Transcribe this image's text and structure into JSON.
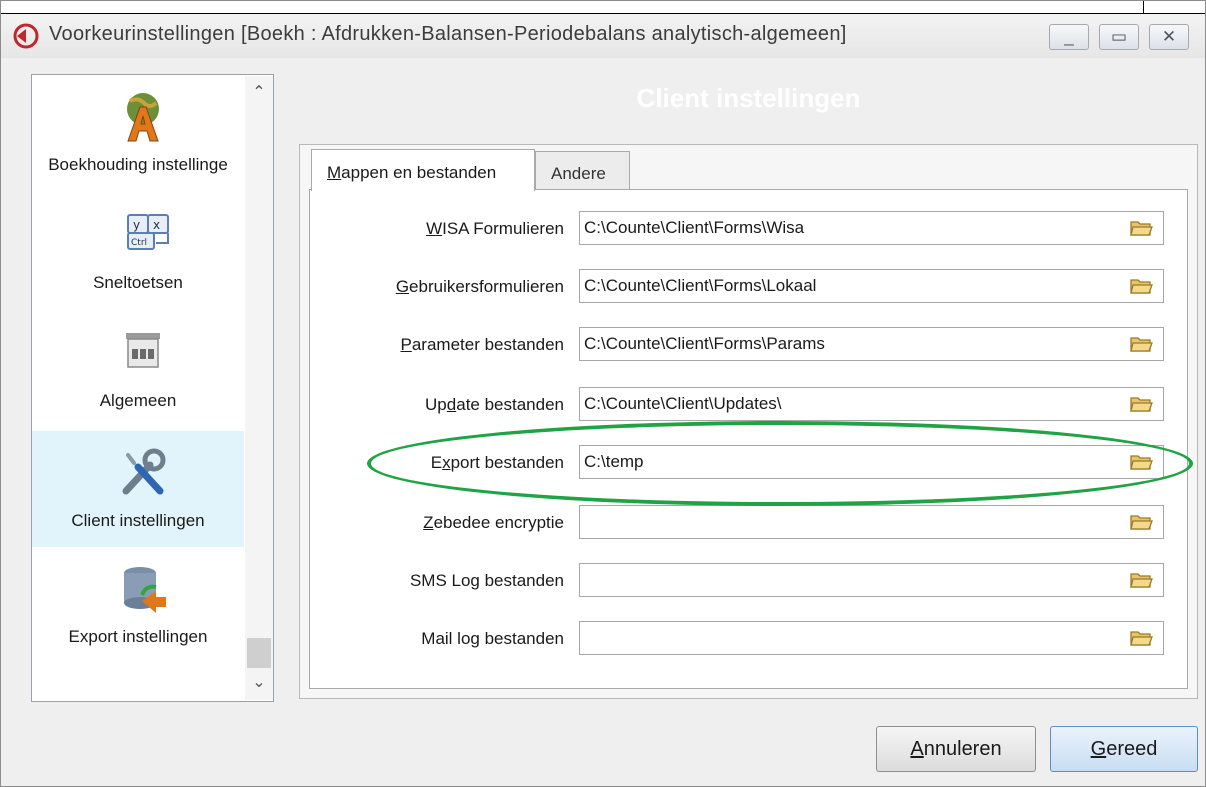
{
  "window": {
    "title": "Voorkeurinstellingen [Boekh : Afdrukken-Balansen-Periodebalans analytisch-algemeen]",
    "minimize_symbol": "_",
    "maximize_symbol": "▭",
    "close_symbol": "✕"
  },
  "sidebar": {
    "items": [
      {
        "label": "Boekhouding instellinge",
        "icon": "accounting-globe-icon"
      },
      {
        "label": "Sneltoetsen",
        "icon": "keyboard-shortcut-icon"
      },
      {
        "label": "Algemeen",
        "icon": "general-settings-icon"
      },
      {
        "label": "Client instellingen",
        "icon": "tools-wrench-screwdriver-icon",
        "selected": true
      },
      {
        "label": "Export instellingen",
        "icon": "database-export-icon"
      }
    ],
    "scroll_up": "⌃",
    "scroll_down": "⌄"
  },
  "section": {
    "title": "Client instellingen"
  },
  "tabs": {
    "active": {
      "underline": "M",
      "rest": "appen en bestanden"
    },
    "inactive": {
      "label": "Andere"
    }
  },
  "fields": [
    {
      "pre": "",
      "ul": "W",
      "post": "ISA Formulieren",
      "value": "C:\\Counte\\Client\\Forms\\Wisa"
    },
    {
      "pre": "",
      "ul": "G",
      "post": "ebruikersformulieren",
      "value": "C:\\Counte\\Client\\Forms\\Lokaal"
    },
    {
      "pre": "",
      "ul": "P",
      "post": "arameter bestanden",
      "value": "C:\\Counte\\Client\\Forms\\Params"
    },
    {
      "pre": "Up",
      "ul": "d",
      "post": "ate bestanden",
      "value": "C:\\Counte\\Client\\Updates\\"
    },
    {
      "pre": "E",
      "ul": "x",
      "post": "port bestanden",
      "value": "C:\\temp"
    },
    {
      "pre": "",
      "ul": "Z",
      "post": "ebedee encryptie",
      "value": ""
    },
    {
      "pre": "SMS Log bestanden",
      "ul": "",
      "post": "",
      "value": ""
    },
    {
      "pre": "Mail log bestanden",
      "ul": "",
      "post": "",
      "value": ""
    }
  ],
  "buttons": {
    "cancel": {
      "underline": "A",
      "rest": "nnuleren"
    },
    "done": {
      "underline": "G",
      "rest": "ereed"
    }
  },
  "colors": {
    "highlight": "#1fa344",
    "selected_item": "#e2f4fb"
  }
}
